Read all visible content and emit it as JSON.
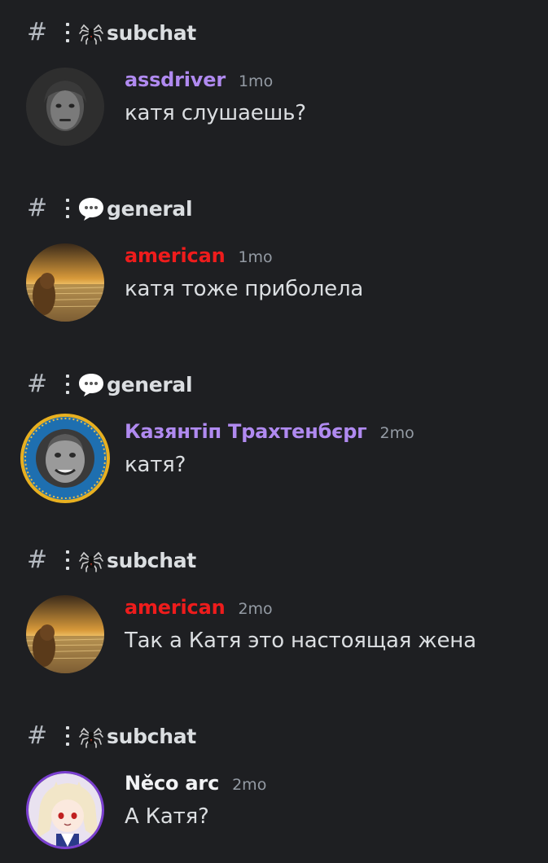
{
  "results": [
    {
      "channel": {
        "name": "subchat",
        "emoji": "spider-icon"
      },
      "author": {
        "name": "assdriver",
        "color": "#b08af0"
      },
      "timestamp": "1mo",
      "message": "катя слушаешь?"
    },
    {
      "channel": {
        "name": "general",
        "emoji": "speech-bubble-icon"
      },
      "author": {
        "name": "american",
        "color": "#ee1c1c"
      },
      "timestamp": "1mo",
      "message": "катя тоже приболела"
    },
    {
      "channel": {
        "name": "general",
        "emoji": "speech-bubble-icon"
      },
      "author": {
        "name": "Казянтіп Трахтенбєрг",
        "color": "#b08af0"
      },
      "timestamp": "2mo",
      "message": "катя?"
    },
    {
      "channel": {
        "name": "subchat",
        "emoji": "spider-icon"
      },
      "author": {
        "name": "american",
        "color": "#ee1c1c"
      },
      "timestamp": "2mo",
      "message": "Так а Катя это настоящая жена"
    },
    {
      "channel": {
        "name": "subchat",
        "emoji": "spider-icon"
      },
      "author": {
        "name": "Něco arc",
        "color": "#f2f3f5"
      },
      "timestamp": "2mo",
      "message": "А Катя?"
    }
  ],
  "icons": {
    "hash": "#"
  }
}
